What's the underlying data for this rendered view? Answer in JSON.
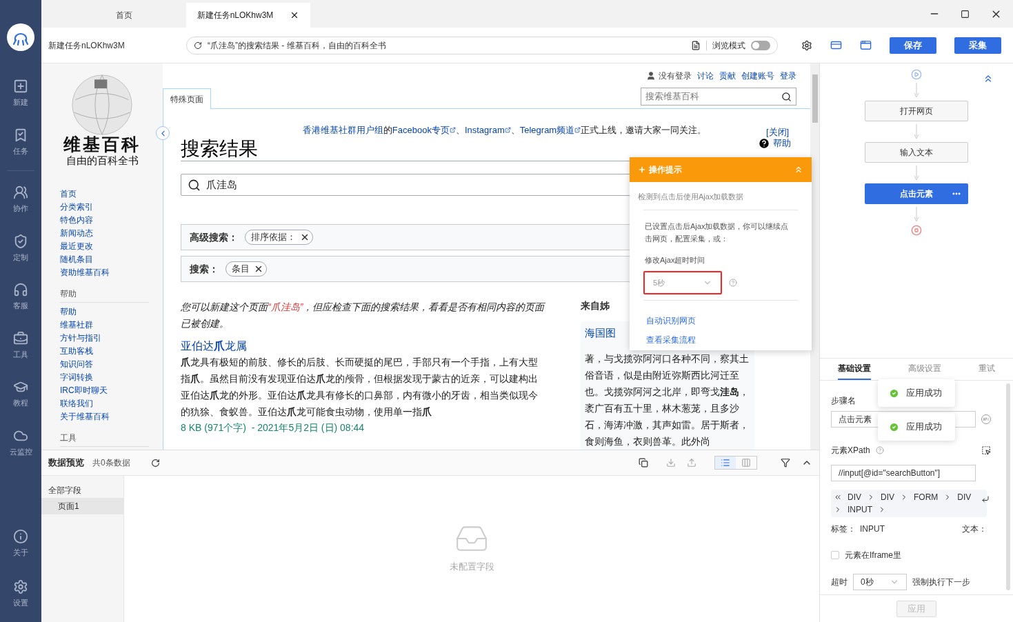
{
  "rail": {
    "items": [
      {
        "label": "新建",
        "kind": "new"
      },
      {
        "label": "任务",
        "kind": "task"
      },
      {
        "label": "协作",
        "kind": "team"
      },
      {
        "label": "定制",
        "kind": "custom"
      },
      {
        "label": "客服",
        "kind": "service"
      },
      {
        "label": "工具",
        "kind": "tools"
      },
      {
        "label": "教程",
        "kind": "tutorial"
      },
      {
        "label": "云监控",
        "kind": "cloud"
      }
    ],
    "bottom": [
      {
        "label": "关于",
        "kind": "about"
      },
      {
        "label": "设置",
        "kind": "settings"
      }
    ]
  },
  "tabs": [
    {
      "label": "首页",
      "selected": false
    },
    {
      "label": "新建任务nLOKhw3M",
      "selected": true
    }
  ],
  "address_bar": {
    "task_name": "新建任务nLOKhw3M",
    "url": "“爪洼岛”的搜索结果 - 维基百科，自由的百科全书",
    "browse_mode": {
      "label": "浏览模式",
      "on": false
    },
    "buttons": [
      "保存",
      "采集"
    ]
  },
  "wiki": {
    "logo_title": "维基百科",
    "logo_subtitle": "自由的百科全书",
    "nav": [
      {
        "items": [
          "首页",
          "分类索引",
          "特色内容",
          "新闻动态",
          "最近更改",
          "随机条目",
          "资助维基百科"
        ]
      },
      {
        "heading": "帮助",
        "items": [
          "帮助",
          "维基社群",
          "方针与指引",
          "互助客栈",
          "知识问答",
          "字词转换",
          "IRC即时聊天",
          "联络我们",
          "关于维基百科"
        ]
      },
      {
        "heading": "工具"
      }
    ],
    "user_status": "没有登录",
    "user_links": [
      "讨论",
      "贡献",
      "创建账号",
      "登录"
    ],
    "page_tab": "特殊页面",
    "search_placeholder": "搜索维基百科",
    "banner": [
      {
        "text": "香港维基社群用户组",
        "link": true,
        "external": false
      },
      {
        "text": "的",
        "link": false,
        "external": false
      },
      {
        "text": "Facebook专页",
        "link": true,
        "external": true
      },
      {
        "text": "、",
        "link": false,
        "external": false
      },
      {
        "text": "Instagram",
        "link": true,
        "external": true
      },
      {
        "text": "、",
        "link": false,
        "external": false
      },
      {
        "text": "Telegram频道",
        "link": true,
        "external": true
      },
      {
        "text": "正式上线，邀请大家一同关注。",
        "link": false,
        "external": false
      }
    ],
    "banner_close": "[关闭]",
    "help": "帮助",
    "heading": "搜索结果",
    "query": "爪洼岛",
    "filters": [
      {
        "label": "高级搜索：",
        "chip": "排序依据："
      },
      {
        "label": "搜索：",
        "chip": "条目"
      }
    ],
    "note": {
      "before": "您可以新建这个页面",
      "link": "“爪洼岛”",
      "after": "，但应检查下面的搜索结果，看看是否有相同内容的页面已被创建。"
    },
    "result": {
      "title": "亚伯达**爪**龙属",
      "snippet": "**爪**龙具有极短的前肢、修长的后肢、长而硬挺的尾巴，手部只有一个手指，上有大型指**爪**。虽然目前没有发现亚伯达**爪**龙的颅骨，但根据发现于蒙古的近亲，可以建构出亚伯达**爪**龙的外形。亚伯达**爪**龙具有修长的口鼻部，内有微小的牙齿，相当类似现今的犰狳、食蚁兽。亚伯达**爪**龙可能食虫动物，使用单一指**爪**",
      "meta": "8 KB (971个字)  - 2021年5月2日 (日) 08:44"
    },
    "sister": {
      "heading": "来自姊",
      "title": "海国图",
      "snippet": "著，与戈揽弥阿河口各种不同，察其土俗音语，似是由附近弥斯西比河迁至也。戈揽弥阿河之北岸，即弯戈**洼岛**，袤广百有五十里，林木葱茏，且多沙石，海涛冲激，其声如雷。居于斯者，食则海鱼，衣则兽革。此外尚"
    }
  },
  "tip": {
    "title": "操作提示",
    "detected": "检测到点击后使用Ajax加载数据",
    "body": "已设置点击后Ajax加载数据，你可以继续点击网页，配置采集，或：",
    "timeout_label": "修改Ajax超时时间",
    "timeout_value": "5秒",
    "links": [
      "自动识别网页",
      "查看采集流程"
    ]
  },
  "preview": {
    "title": "数据预览",
    "count": "共0条数据",
    "fields": "全部字段",
    "pages": [
      {
        "label": "页面1",
        "selected": true
      }
    ],
    "empty": "未配置字段"
  },
  "flow": {
    "steps": [
      {
        "label": "打开网页",
        "selected": false
      },
      {
        "label": "输入文本",
        "selected": false
      },
      {
        "label": "点击元素",
        "selected": true
      }
    ]
  },
  "settings": {
    "tabs": [
      {
        "label": "基础设置",
        "selected": true
      },
      {
        "label": "高级设置",
        "selected": false
      },
      {
        "label": "重试",
        "selected": false
      }
    ],
    "step_label": "步骤名",
    "step_value": "点击元素",
    "xpath_label": "元素XPath",
    "xpath_value": "//input[@id=\"searchButton\"]",
    "path": [
      "DIV",
      "DIV",
      "FORM",
      "DIV",
      "INPUT"
    ],
    "tag_label": "标签：",
    "tag_value": "INPUT",
    "text_label": "文本：",
    "iframe": {
      "label": "元素在Iframe里",
      "checked": false
    },
    "timeout_label": "超时",
    "timeout_value": "0秒",
    "force_label": "强制执行下一步",
    "apply": {
      "label": "应用",
      "disabled": true
    },
    "toasts": [
      "应用成功",
      "应用成功"
    ]
  }
}
